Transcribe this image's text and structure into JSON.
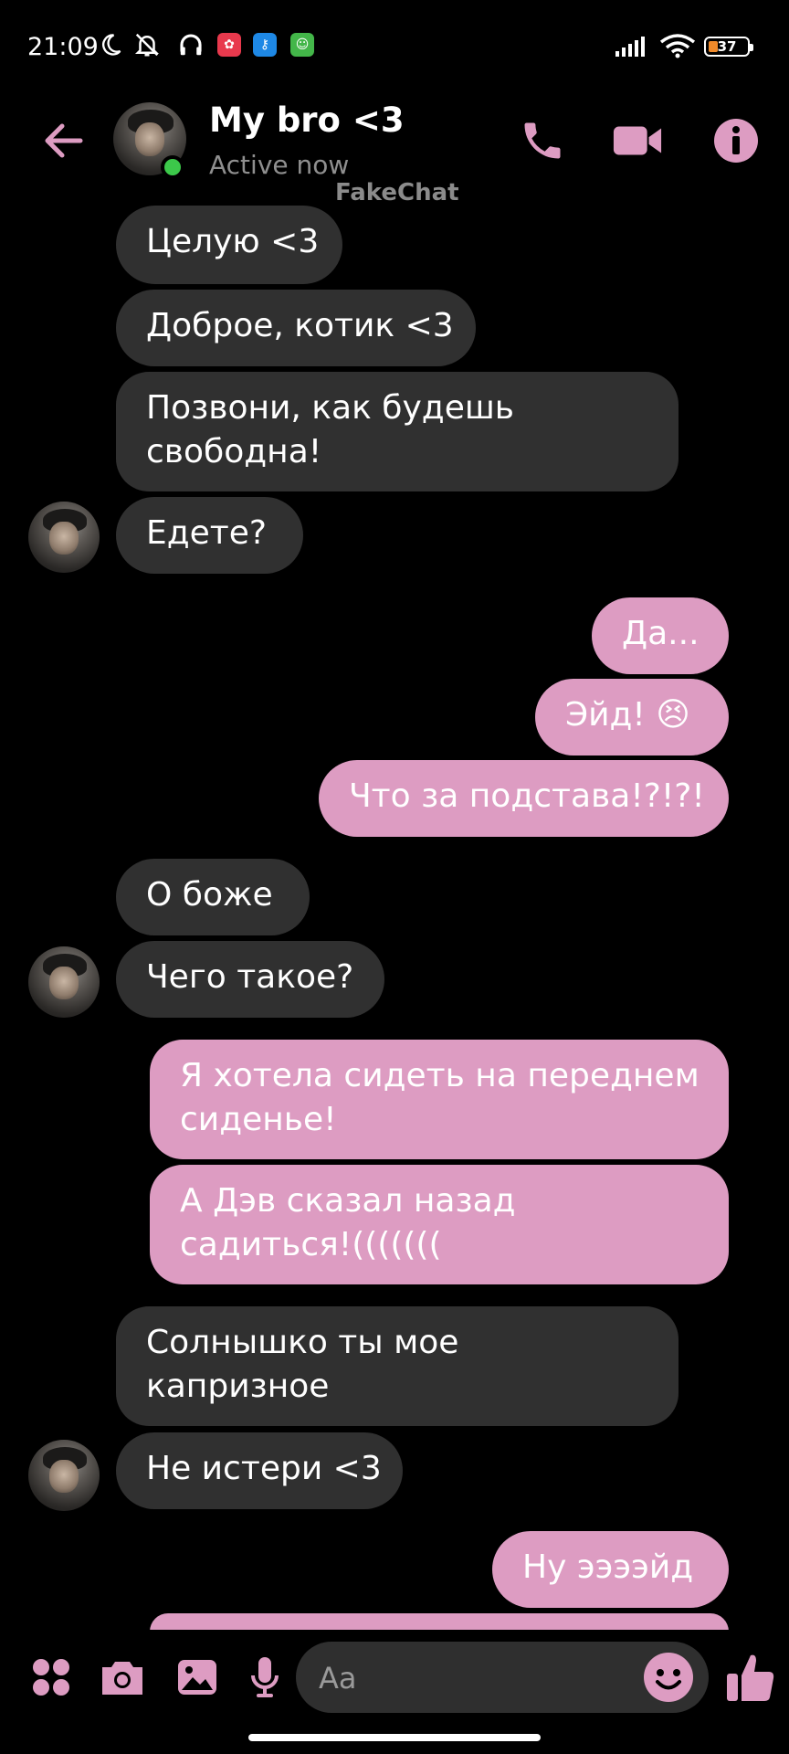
{
  "status_bar": {
    "time": "21:09",
    "icons": [
      "moon-icon",
      "notifications-off-icon",
      "headphones-icon",
      "app-flower-icon",
      "app-key-icon",
      "app-cat-icon",
      "signal-icon",
      "wifi-icon",
      "battery-icon"
    ],
    "battery": "37"
  },
  "header": {
    "title": "My bro <3",
    "subtitle": "Active now",
    "watermark": "FakeChat",
    "accent_color": "#dd9cc2"
  },
  "messages": [
    {
      "side": "in",
      "text": "Целую <3"
    },
    {
      "side": "in",
      "text": "Доброе, котик <3"
    },
    {
      "side": "in",
      "lines": [
        "Позвони, как будешь",
        "свободна!"
      ]
    },
    {
      "side": "in",
      "text": "Едете?"
    },
    {
      "side": "out",
      "text": "Да..."
    },
    {
      "side": "out",
      "text": "Эйд! 😣"
    },
    {
      "side": "out",
      "text": "Что за подстава!?!?!"
    },
    {
      "side": "in",
      "text": "О боже"
    },
    {
      "side": "in",
      "text": "Чего такое?"
    },
    {
      "side": "out",
      "lines": [
        "Я хотела сидеть на переднем",
        "сиденье!"
      ]
    },
    {
      "side": "out",
      "lines": [
        "А Дэв сказал назад",
        "садиться!((((((("
      ]
    },
    {
      "side": "in",
      "lines": [
        "Солнышко ты мое",
        "капризное"
      ]
    },
    {
      "side": "in",
      "text": "Не истери <3"
    },
    {
      "side": "out",
      "text": "Ну ээээйд"
    }
  ],
  "composer": {
    "placeholder": "Aa"
  }
}
